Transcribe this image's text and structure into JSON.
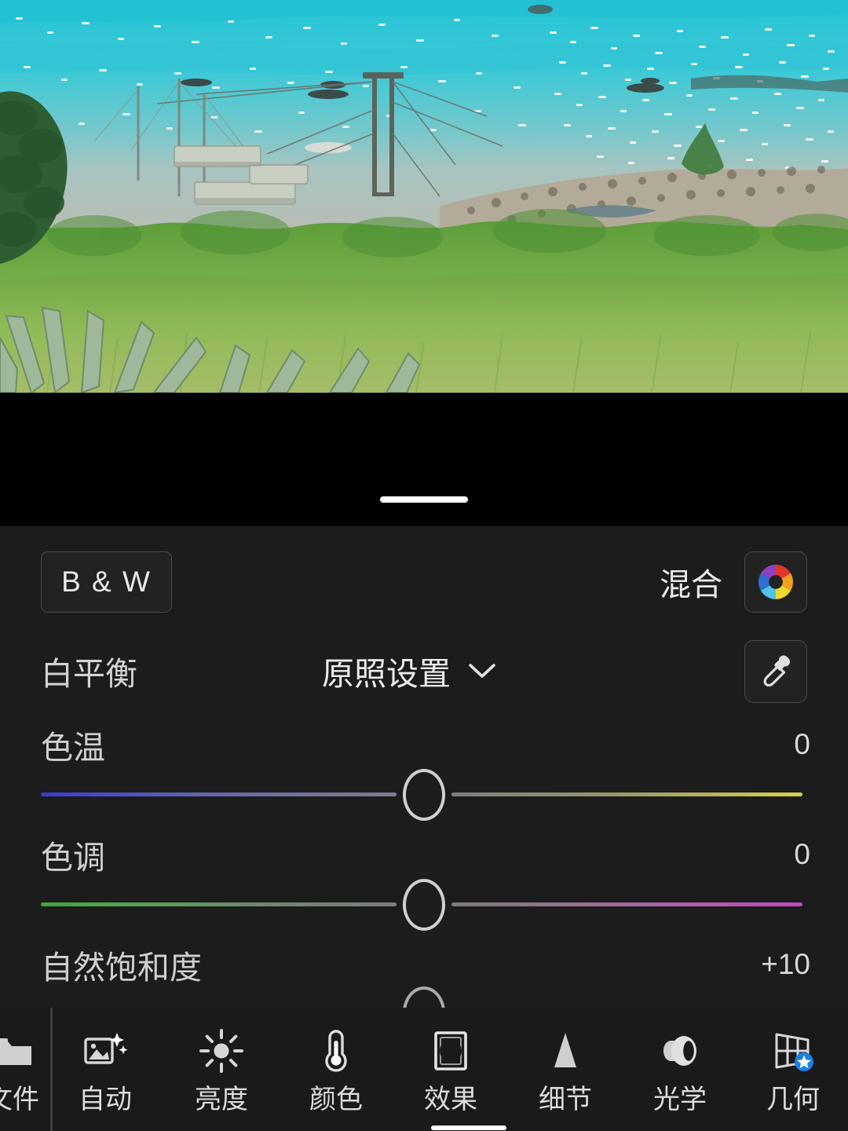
{
  "app": {
    "name": "photo-editor",
    "panel_bg": "#1c1c1c",
    "toolbar_bg": "#1a1a1a",
    "accent": "#1a7fe8"
  },
  "photo": {
    "description": "Coastal seascape with turquoise water, moored boats and rafts, rocky shore and green grassy foreground",
    "water_color": "#2fc0cf",
    "grass_color": "#8fb35a"
  },
  "drag_handle": {
    "name": "panel-drag-handle",
    "color": "#ffffff"
  },
  "panel": {
    "bw_button": {
      "label": "B & W"
    },
    "mix": {
      "label": "混合",
      "icon": "color-wheel-icon"
    },
    "white_balance": {
      "label": "白平衡",
      "value": "原照设置",
      "chevron": "chevron-down-icon",
      "eyedropper": "eyedropper-icon"
    },
    "sliders": [
      {
        "name": "色温",
        "value": "0",
        "knob_position_pct": 50,
        "gradient_left": [
          "#3a3ad4",
          "#7c7c8c"
        ],
        "gradient_right": [
          "#7d7d7d",
          "#d2d251"
        ]
      },
      {
        "name": "色调",
        "value": "0",
        "knob_position_pct": 50,
        "gradient_left": [
          "#3da83d",
          "#7e7e7e"
        ],
        "gradient_right": [
          "#7d7d7d",
          "#c44bc0"
        ]
      },
      {
        "name": "自然饱和度",
        "value": "+10",
        "knob_position_pct": 50,
        "gradient_left": [
          "#6a6a6a",
          "#7e7e7e"
        ],
        "gradient_right": [
          "#7d7d7d",
          "#8a8a8a"
        ]
      }
    ]
  },
  "toolbar": {
    "items": [
      {
        "label": "文件",
        "icon": "file-icon",
        "active": false,
        "partial": true
      },
      {
        "label": "自动",
        "icon": "auto-magic-icon",
        "active": false
      },
      {
        "label": "亮度",
        "icon": "sun-icon",
        "active": false
      },
      {
        "label": "颜色",
        "icon": "thermometer-icon",
        "active": false
      },
      {
        "label": "效果",
        "icon": "vignette-icon",
        "active": true
      },
      {
        "label": "细节",
        "icon": "triangle-icon",
        "active": false
      },
      {
        "label": "光学",
        "icon": "lens-icon",
        "active": false
      },
      {
        "label": "几何",
        "icon": "perspective-grid-icon",
        "active": false,
        "badge": "star-badge"
      }
    ]
  }
}
